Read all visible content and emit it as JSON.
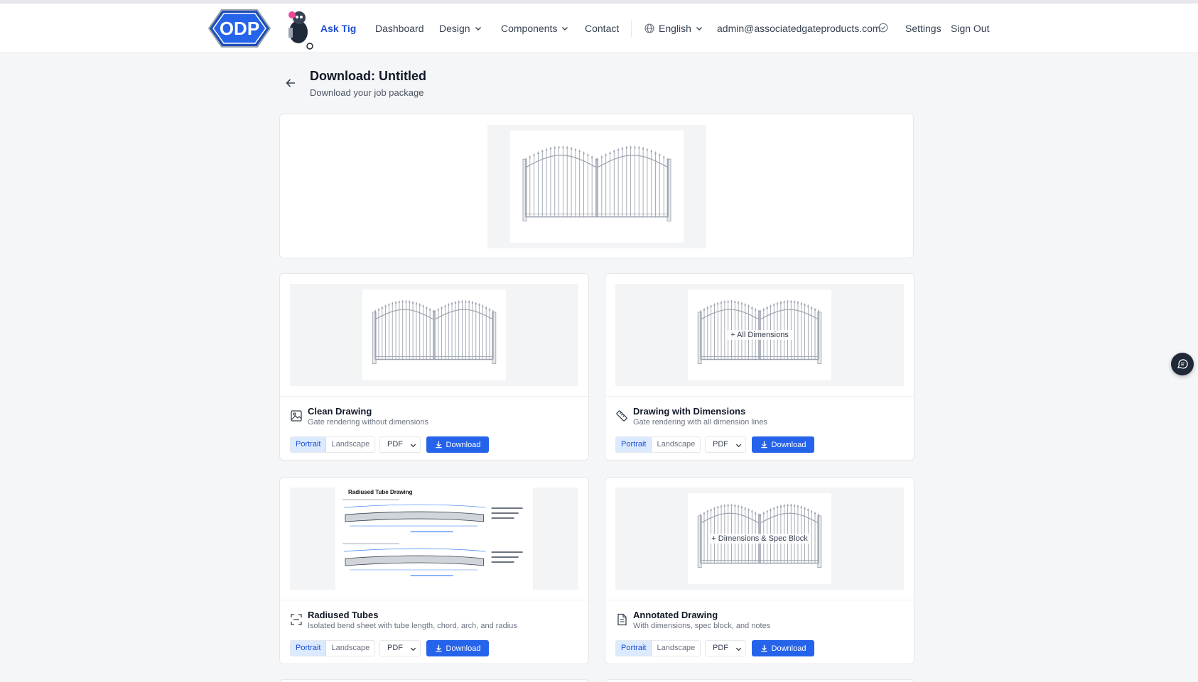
{
  "nav": {
    "logo_text": "ODP",
    "brand": "Ask Tig",
    "dashboard": "Dashboard",
    "design": "Design",
    "components": "Components",
    "contact": "Contact",
    "language": "English",
    "email": "admin@associatedgateproducts.com",
    "settings": "Settings",
    "signout": "Sign Out"
  },
  "header": {
    "title": "Download: Untitled",
    "subtitle": "Download your job package"
  },
  "cards": [
    {
      "title": "Clean Drawing",
      "desc": "Gate rendering without dimensions",
      "overlay": "",
      "icon": "image-icon"
    },
    {
      "title": "Drawing with Dimensions",
      "desc": "Gate rendering with all dimension lines",
      "overlay": "+ All Dimensions",
      "icon": "ruler-icon"
    },
    {
      "title": "Radiused Tubes",
      "desc": "Isolated bend sheet with tube length, chord, arch, and radius",
      "overlay": "",
      "icon": "frame-icon",
      "sheet_title": "Radiused Tube Drawing"
    },
    {
      "title": "Annotated Drawing",
      "desc": "With dimensions, spec block, and notes",
      "overlay": "+ Dimensions & Spec Block",
      "icon": "document-icon"
    }
  ],
  "controls": {
    "portrait": "Portrait",
    "landscape": "Landscape",
    "format": "PDF",
    "download": "Download"
  },
  "colors": {
    "primary": "#2563eb",
    "brand": "#1d4ed8",
    "active_bg": "#dbeafe"
  }
}
